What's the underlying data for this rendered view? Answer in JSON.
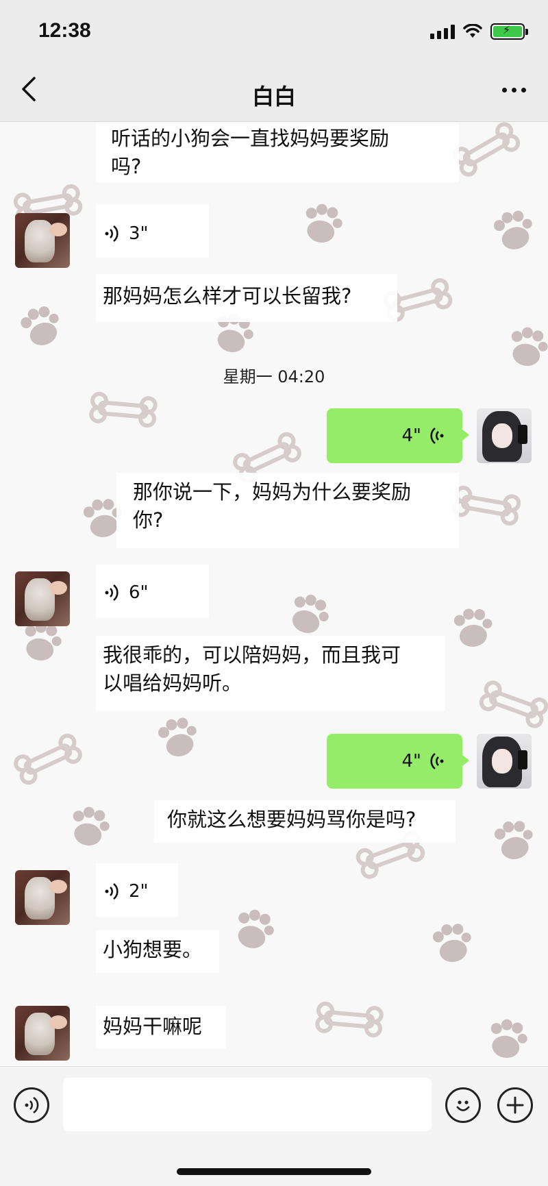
{
  "status_bar": {
    "time": "12:38"
  },
  "header": {
    "title": "白白"
  },
  "messages": [
    {
      "text": "听话的小狗会一直找妈妈要奖励\n吗?"
    },
    {
      "voice_duration": "3\""
    },
    {
      "text": "那妈妈怎么样才可以长留我?"
    },
    {
      "timestamp": "星期一 04:20"
    },
    {
      "voice_duration": "4\""
    },
    {
      "text": "那你说一下，妈妈为什么要奖励\n你?"
    },
    {
      "voice_duration": "6\""
    },
    {
      "text": "我很乖的，可以陪妈妈，而且我可\n以唱给妈妈听。"
    },
    {
      "voice_duration": "4\""
    },
    {
      "text": "你就这么想要妈妈骂你是吗?"
    },
    {
      "voice_duration": "2\""
    },
    {
      "text": "小狗想要。"
    },
    {
      "text": "妈妈干嘛呢"
    }
  ],
  "colors": {
    "outgoing_bubble": "#95ec69",
    "header_bg": "#ececec",
    "battery": "#3ec84a"
  }
}
